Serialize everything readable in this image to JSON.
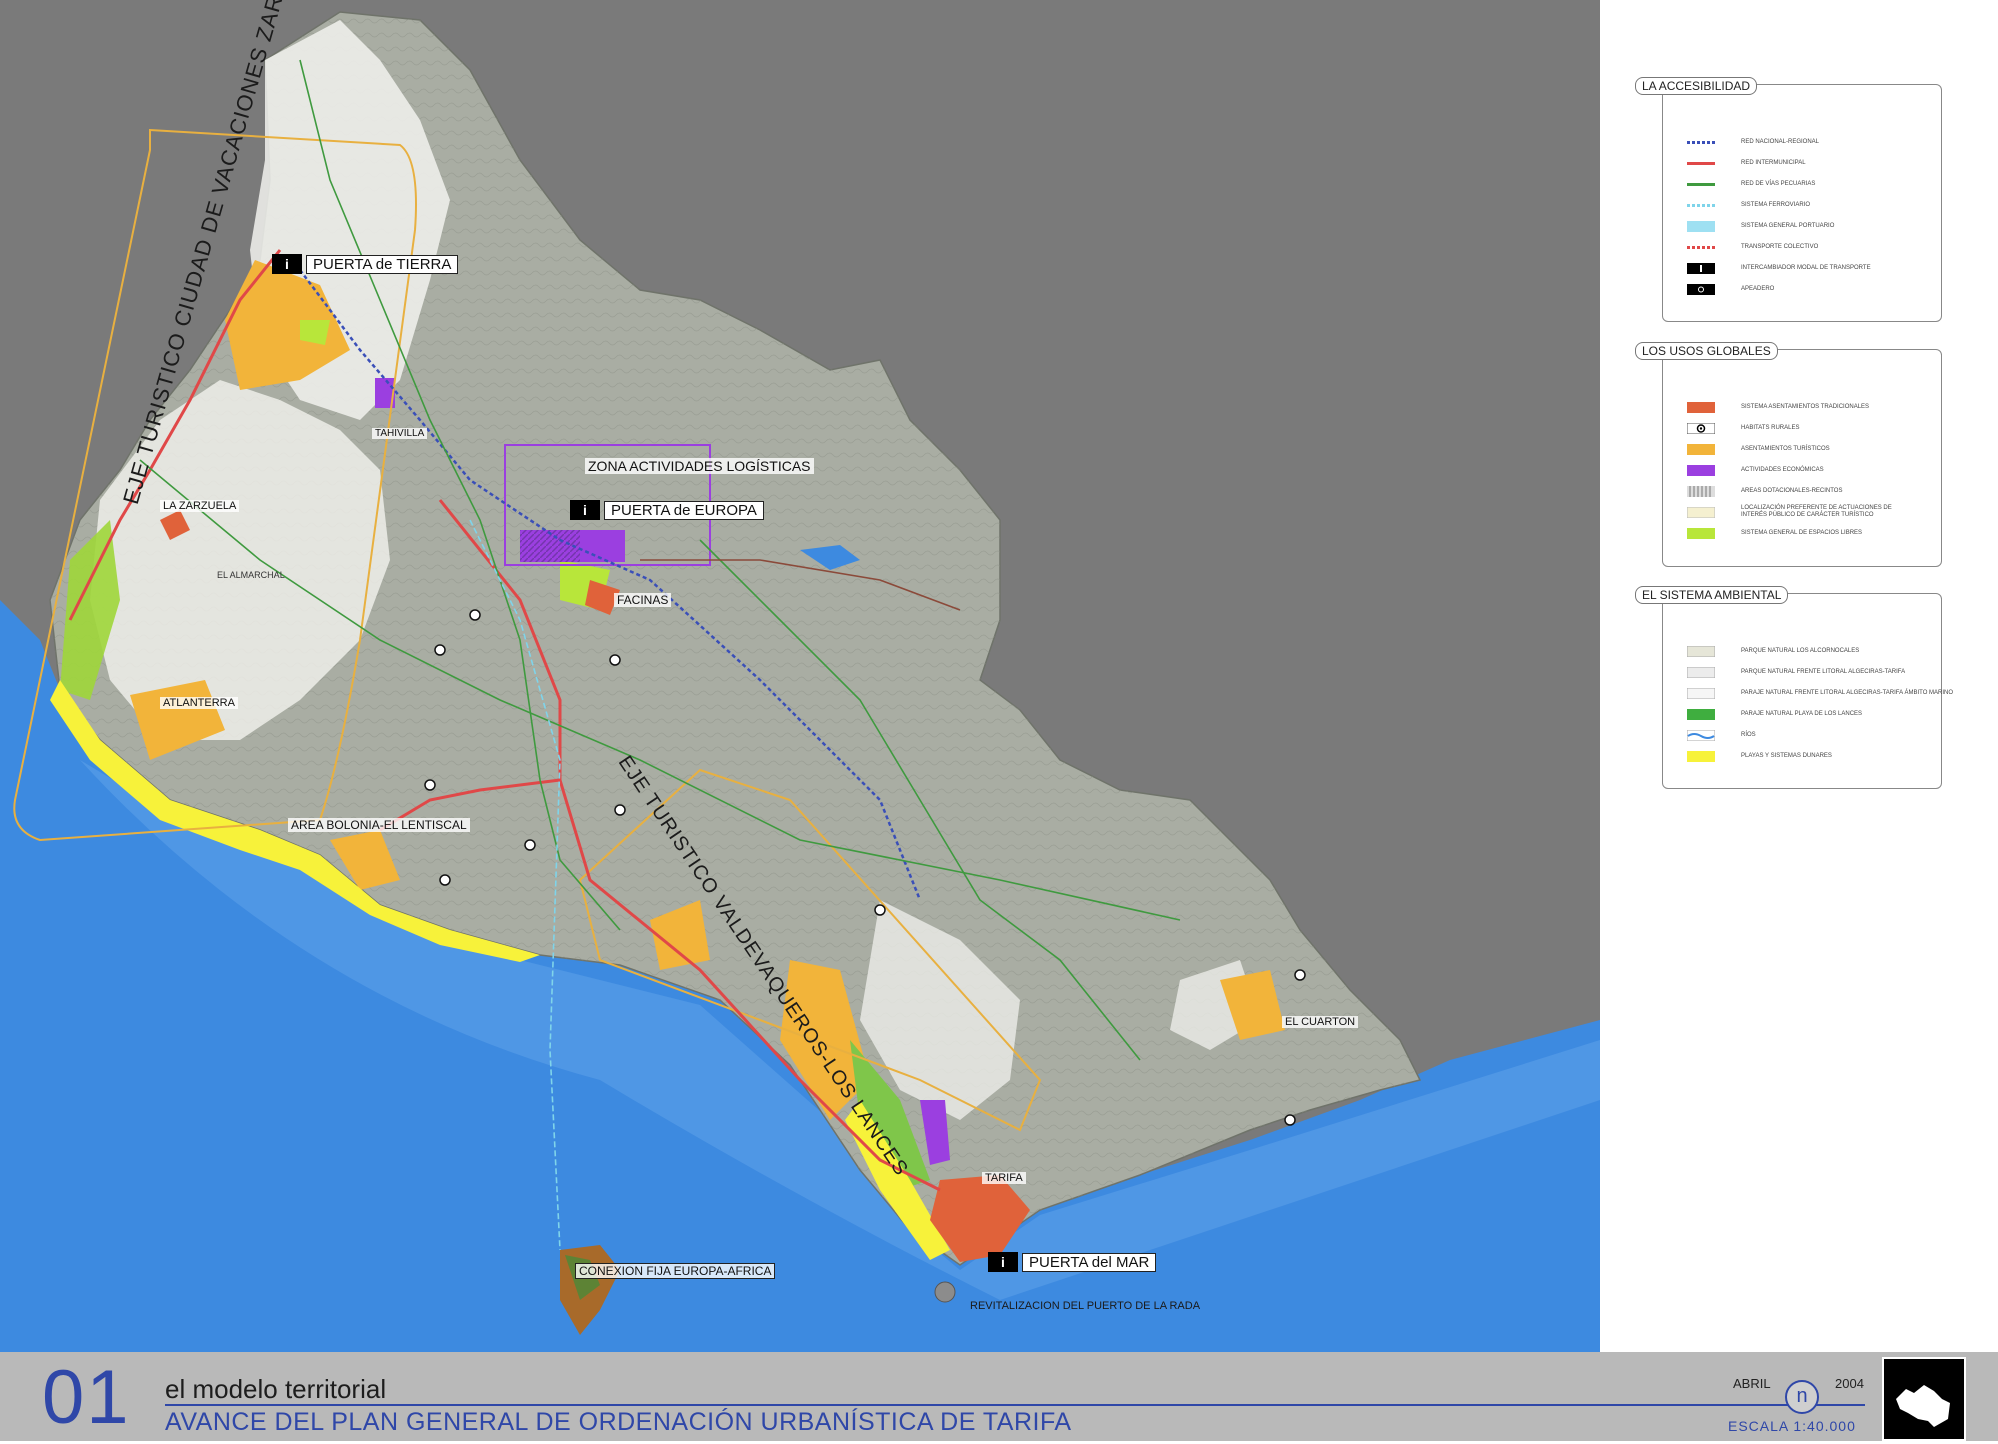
{
  "map": {
    "places": {
      "puerta_tierra": "PUERTA de TIERRA",
      "puerta_europa": "PUERTA de EUROPA",
      "puerta_mar": "PUERTA del MAR",
      "zona_logistica": "ZONA ACTIVIDADES LOGÍSTICAS",
      "la_zarzuela": "LA ZARZUELA",
      "atlanterra": "ATLANTERRA",
      "area_bolonia": "AREA BOLONIA-EL LENTISCAL",
      "facinas": "FACINAS",
      "tahivilla": "TAHIVILLA",
      "tarifa": "TARIFA",
      "el_cuarton": "EL CUARTON",
      "conexion": "CONEXION FIJA EUROPA-AFRICA",
      "revitalizacion": "REVITALIZACION DEL PUERTO DE LA RADA",
      "el_almarchal": "EL ALMARCHAL"
    },
    "axes": {
      "eje_norte": "EJE TURISTICO CIUDAD DE VACACIONES ZARZUELA-ATLANTERRA",
      "eje_sur": "EJE TURISTICO VALDEVAQUEROS-LOS LANCES"
    },
    "colors": {
      "sea": "#3d8ae0",
      "land": "#a9ada3",
      "background": "#7a7a7a",
      "tourist": "#f2b43a",
      "urban": "#e0623a",
      "economic": "#9b3fe0",
      "green": "#9fd63a",
      "beach": "#f7f23a"
    }
  },
  "legend": {
    "accesibilidad": {
      "title": "LA ACCESIBILIDAD",
      "items": [
        {
          "label": "RED NACIONAL-REGIONAL",
          "swatch": "dotted-blue"
        },
        {
          "label": "RED INTERMUNICIPAL",
          "swatch": "line-red"
        },
        {
          "label": "RED DE VÍAS PECUARIAS",
          "swatch": "line-green"
        },
        {
          "label": "SISTEMA FERROVIARIO",
          "swatch": "dotted-cyan"
        },
        {
          "label": "SISTEMA GENERAL PORTUARIO",
          "swatch": "fill-cyan"
        },
        {
          "label": "TRANSPORTE COLECTIVO",
          "swatch": "dotted-red"
        },
        {
          "label": "INTERCAMBIADOR MODAL DE TRANSPORTE",
          "swatch": "black-i"
        },
        {
          "label": "APEADERO",
          "swatch": "black-o"
        }
      ]
    },
    "usos": {
      "title": "LOS USOS GLOBALES",
      "items": [
        {
          "label": "SISTEMA ASENTAMIENTOS TRADICIONALES",
          "swatch": "#e0623a"
        },
        {
          "label": "HABITATS RURALES",
          "swatch": "ring"
        },
        {
          "label": "ASENTAMIENTOS TURÍSTICOS",
          "swatch": "#f2b43a"
        },
        {
          "label": "ACTIVIDADES ECONÓMICAS",
          "swatch": "#9b3fe0"
        },
        {
          "label": "AREAS DOTACIONALES-RECINTOS",
          "swatch": "striped"
        },
        {
          "label": "LOCALIZACIÓN PREFERENTE DE ACTUACIONES DE INTERÉS PÚBLICO DE CARÁCTER TURÍSTICO",
          "swatch": "#f5f0d0"
        },
        {
          "label": "SISTEMA GENERAL DE ESPACIOS LIBRES",
          "swatch": "#b8e63a"
        }
      ]
    },
    "ambiental": {
      "title": "EL SISTEMA AMBIENTAL",
      "items": [
        {
          "label": "PARQUE NATURAL LOS ALCORNOCALES",
          "swatch": "#e6e6d8"
        },
        {
          "label": "PARQUE NATURAL FRENTE LITORAL ALGECIRAS-TARIFA",
          "swatch": "#ececec"
        },
        {
          "label": "PARAJE NATURAL FRENTE LITORAL ALGECIRAS-TARIFA ÁMBITO MARINO",
          "swatch": "#f6f6f6"
        },
        {
          "label": "PARAJE NATURAL PLAYA DE LOS LANCES",
          "swatch": "#3fae3f"
        },
        {
          "label": "RÍOS",
          "swatch": "river"
        },
        {
          "label": "PLAYAS Y SISTEMAS DUNARES",
          "swatch": "#f7f23a"
        }
      ]
    }
  },
  "footer": {
    "number": "01",
    "subtitle": "el modelo territorial",
    "title": "AVANCE DEL PLAN GENERAL DE ORDENACIÓN URBANÍSTICA DE TARIFA",
    "month": "ABRIL",
    "year": "2004",
    "north": "n",
    "scale": "ESCALA 1:40.000"
  }
}
